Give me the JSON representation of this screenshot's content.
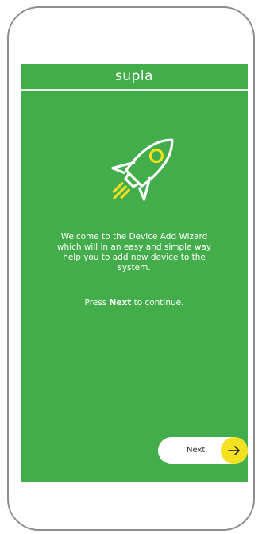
{
  "header": {
    "title": "supla"
  },
  "wizard": {
    "welcome_text": "Welcome to the Device Add Wizard which will in an easy and simple way help you to add new device to the system.",
    "press_prefix": "Press",
    "press_bold": "Next",
    "press_suffix": "to continue."
  },
  "next_button": {
    "label": "Next"
  },
  "icons": {
    "hero": "rocket-icon",
    "next": "arrow-right-icon"
  },
  "colors": {
    "background": "#44ad4b",
    "accent": "#f4e122",
    "button": "#ffffff"
  }
}
